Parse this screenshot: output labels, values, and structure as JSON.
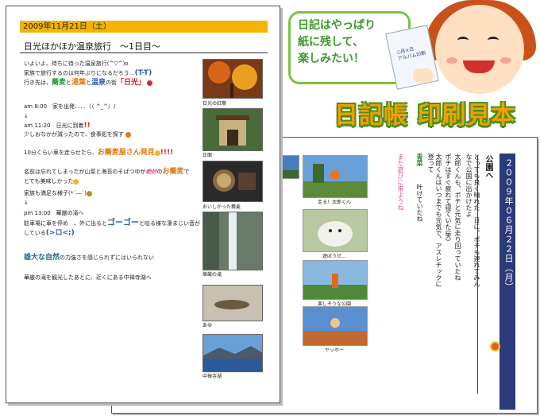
{
  "header": {
    "bubble_lines": [
      "日記はやっぱり",
      "紙に残して、",
      "楽しみたい！"
    ],
    "notebook_label": [
      "○月×日",
      "アルバム印刷"
    ],
    "main_title": "日記帳 印刷見本"
  },
  "front": {
    "date": "2009年11月21日（土）",
    "title": "日光ほかほか温泉旅行　～1日目～",
    "lines": {
      "l1": "いよいよ、待ちに待った温泉旅行(^▽^)o",
      "l2a": "家族で旅行するのは何年ぶりになるだろう…",
      "l2b": "(T-T)",
      "l3a": "行き先は、",
      "l3b": "蕎麦",
      "l3c": "と",
      "l3d": "湯葉",
      "l3e": "と",
      "l3f": "温泉",
      "l3g": "の街",
      "l3h": "「日光」",
      "l4": "am 8:00　家を出発．．．．（（ ^_^）/",
      "l5": "↓",
      "l6a": "am 11:20　日光に到着",
      "l6b": "!!",
      "l7": "少しおなかが減ったので、食事処を探す",
      "l8a": "10分くらい車を走らせたら、",
      "l8b": "お蕎麦屋さん発見",
      "l8c": "!!!!",
      "l9a": "名前は忘れてしまったが山菜と海苔のそばつゆが",
      "l9b": "絶妙",
      "l9c": "の",
      "l9d": "お蕎麦",
      "l9e": "で",
      "l10": "とても美味しかった",
      "l11": "家族も満足な様子(*´―`)",
      "l12": "↓",
      "l13": "pm 13:00　華厳の滝へ",
      "l14a": "駐車場に車を停め　、外に出ると",
      "l14b": "ゴーゴー",
      "l14c": "と唸る様な凄まじい音が",
      "l15a": "している",
      "l15b": "(>ロ<;)",
      "l16a": "雄大な自然",
      "l16b": "の力強さを感じられずにはいられない",
      "l17": "華厳の滝を観光したあとに、近くにある中禅寺湖へ"
    },
    "captions": [
      "日光の紅葉",
      "正面",
      "おいしかった蕎麦",
      "華厳の滝",
      "あゆ",
      "中禅寺湖"
    ]
  },
  "back": {
    "date": "２００９年０６月２２日（月）",
    "title": "公園へ",
    "columns": [
      "とっても良く晴れた　日に、ポチも連れてみんなで公園に出かけたよ",
      "太郎くんも、ポチと元気に走り回っていたね",
      "ポチはすぐ疲れて寝ていた(笑)",
      "太郎くんはいつまでも元気で、アスレチックに登って",
      "青菜",
      "叶けていたね",
      "また遊びに来ようね"
    ],
    "captions": [
      "走る！太郎くん",
      "遊ぼうぜ…",
      "楽しそうな公園",
      "ヤッホー"
    ]
  },
  "colors": {
    "date_bar": "#f2b400",
    "back_bar": "#2b3a78",
    "title_fill": "#f0a000",
    "title_outline": "#4a8f1a",
    "bubble_border": "#7cc242"
  }
}
